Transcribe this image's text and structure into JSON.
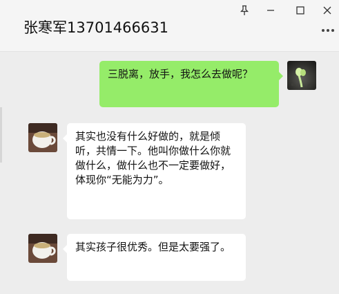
{
  "window": {
    "title": "张寒军13701466631",
    "pin_icon": "pin-icon",
    "minimize_icon": "minimize-icon",
    "maximize_icon": "maximize-icon",
    "close_icon": "close-icon",
    "more_icon": "more-dots-icon"
  },
  "messages": [
    {
      "direction": "out",
      "text": "三脱离，放手，我怎么去做呢？",
      "avatar": "sprout-avatar"
    },
    {
      "direction": "in",
      "text": "其实也没有什么好做的，就是倾听，共情一下。他叫你做什么你就做什么，做什么也不一定要做好，体现你“无能为力”。",
      "avatar": "teacup-avatar"
    },
    {
      "direction": "in",
      "text": "其实孩子很优秀。但是太要强了。",
      "avatar": "teacup-avatar"
    }
  ],
  "colors": {
    "outgoing_bubble": "#95ec69",
    "incoming_bubble": "#ffffff",
    "chat_background": "#ededed",
    "header_background": "#f5f5f5"
  }
}
